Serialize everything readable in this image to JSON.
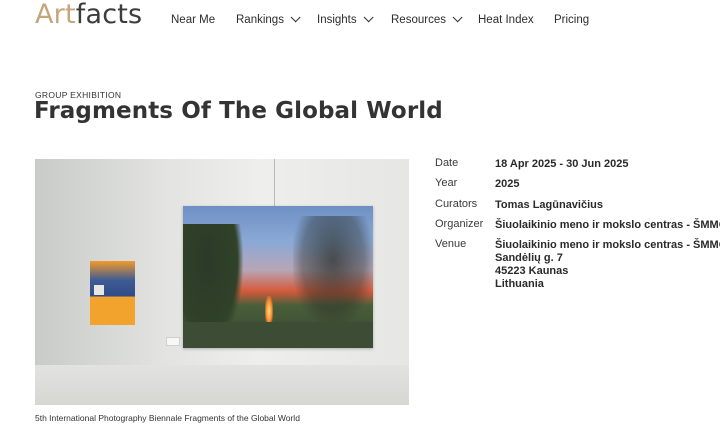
{
  "logo": {
    "part1": "Art",
    "part2": "facts"
  },
  "nav": {
    "near_me": "Near Me",
    "rankings": "Rankings",
    "insights": "Insights",
    "resources": "Resources",
    "heat_index": "Heat Index",
    "pricing": "Pricing"
  },
  "exhibition": {
    "kicker": "GROUP EXHIBITION",
    "title": "Fragments Of The Global World",
    "caption": "5th International Photography Biennale Fragments of the Global World"
  },
  "details": {
    "date_label": "Date",
    "date_value": "18 Apr 2025 - 30 Jun 2025",
    "year_label": "Year",
    "year_value": "2025",
    "curators_label": "Curators",
    "curators_value": "Tomas Lagūnavičius",
    "organizer_label": "Organizer",
    "organizer_value": "Šiuolaikinio meno ir mokslo centras - ŠMMC",
    "venue_label": "Venue",
    "venue_line1": "Šiuolaikinio meno ir mokslo centras - ŠMMC",
    "venue_line2": "Sandėlių g. 7",
    "venue_line3": "45223 Kaunas",
    "venue_line4": "Lithuania"
  },
  "colors": {
    "logo_art": "#c7a57c",
    "logo_facts": "#3c3c3c",
    "text": "#333333"
  }
}
